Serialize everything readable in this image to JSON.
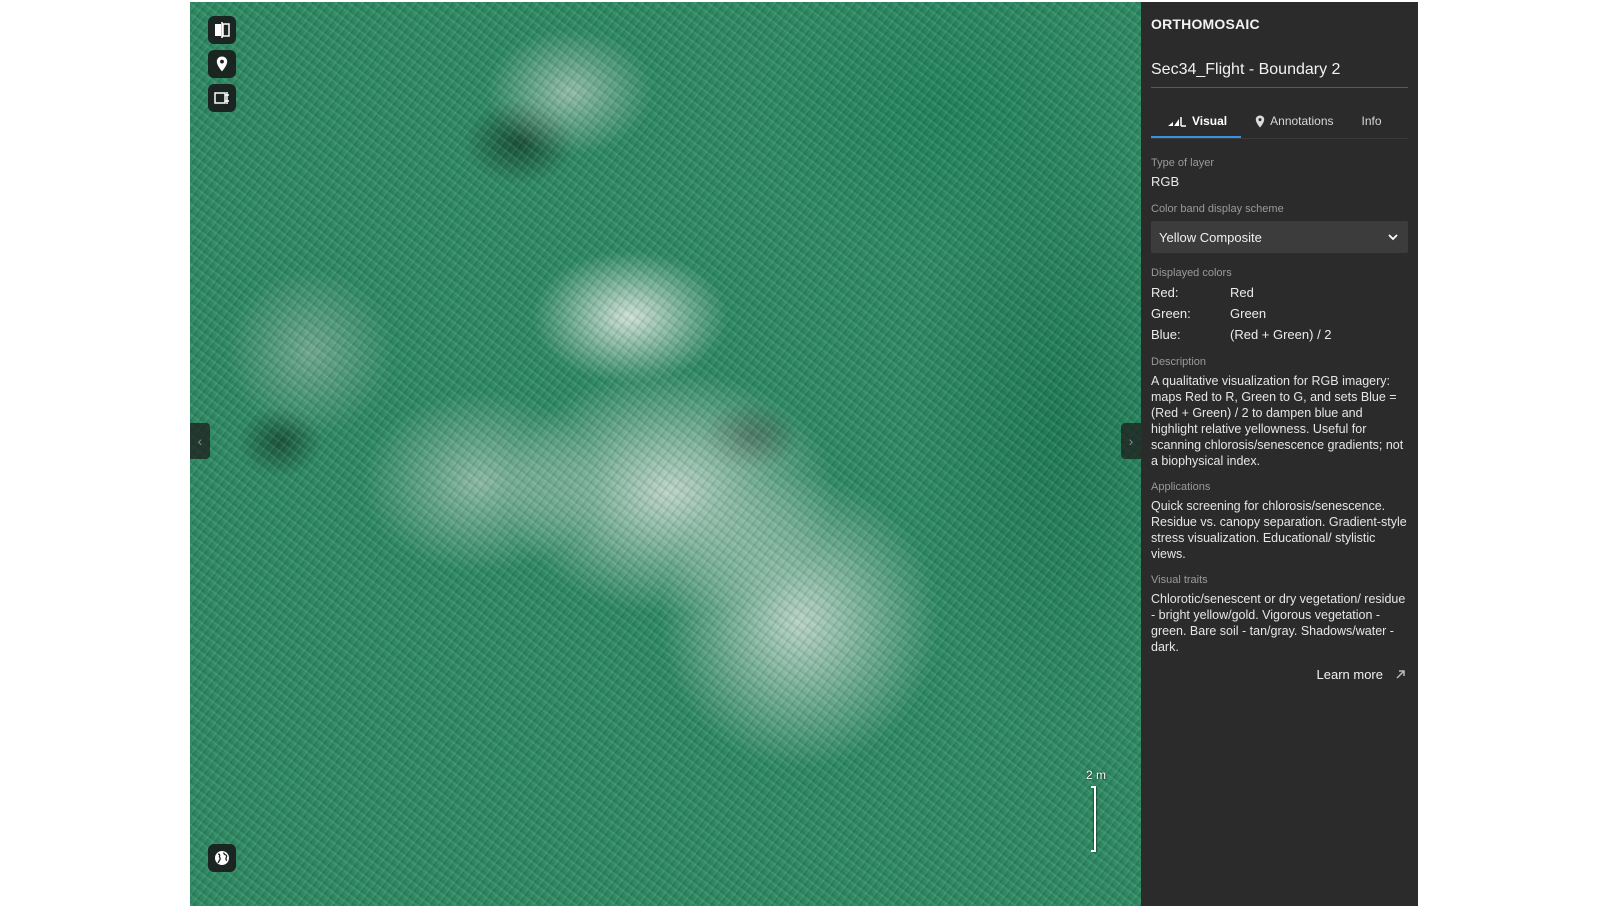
{
  "map": {
    "tools": [
      {
        "icon": "compare-icon"
      },
      {
        "icon": "location-pin-icon"
      },
      {
        "icon": "measure-icon"
      }
    ],
    "globe_icon": "globe-icon",
    "scale_label": "2 m"
  },
  "panel": {
    "kicker": "ORTHOMOSAIC",
    "title": "Sec34_Flight - Boundary 2",
    "tabs": [
      {
        "label": "Visual",
        "icon": "chart-icon",
        "active": true
      },
      {
        "label": "Annotations",
        "icon": "pin-icon",
        "active": false
      },
      {
        "label": "Info",
        "active": false
      }
    ],
    "type_label": "Type of layer",
    "type_value": "RGB",
    "scheme_label": "Color band display scheme",
    "scheme_value": "Yellow Composite",
    "colors_label": "Displayed colors",
    "colors": [
      {
        "key": "Red:",
        "value": "Red"
      },
      {
        "key": "Green:",
        "value": "Green"
      },
      {
        "key": "Blue:",
        "value": "(Red + Green) / 2"
      }
    ],
    "description_label": "Description",
    "description": "A qualitative visualization for RGB imagery: maps Red to R, Green to G, and sets Blue = (Red + Green) / 2 to dampen blue and highlight relative yellowness. Useful for scanning chlorosis/senescence gradients; not a biophysical index.",
    "applications_label": "Applications",
    "applications": "Quick screening for chlorosis/senescence. Residue vs. canopy separation. Gradient-style stress visualization. Educational/ stylistic views.",
    "traits_label": "Visual traits",
    "traits": "Chlorotic/senescent or dry vegetation/ residue - bright yellow/gold. Vigorous vegetation - green. Bare soil - tan/gray. Shadows/water - dark.",
    "learn_more": "Learn more"
  },
  "colors": {
    "accent": "#3d8fe0",
    "panel_bg": "#2b2b2b",
    "map_green": "#2e8a63"
  }
}
